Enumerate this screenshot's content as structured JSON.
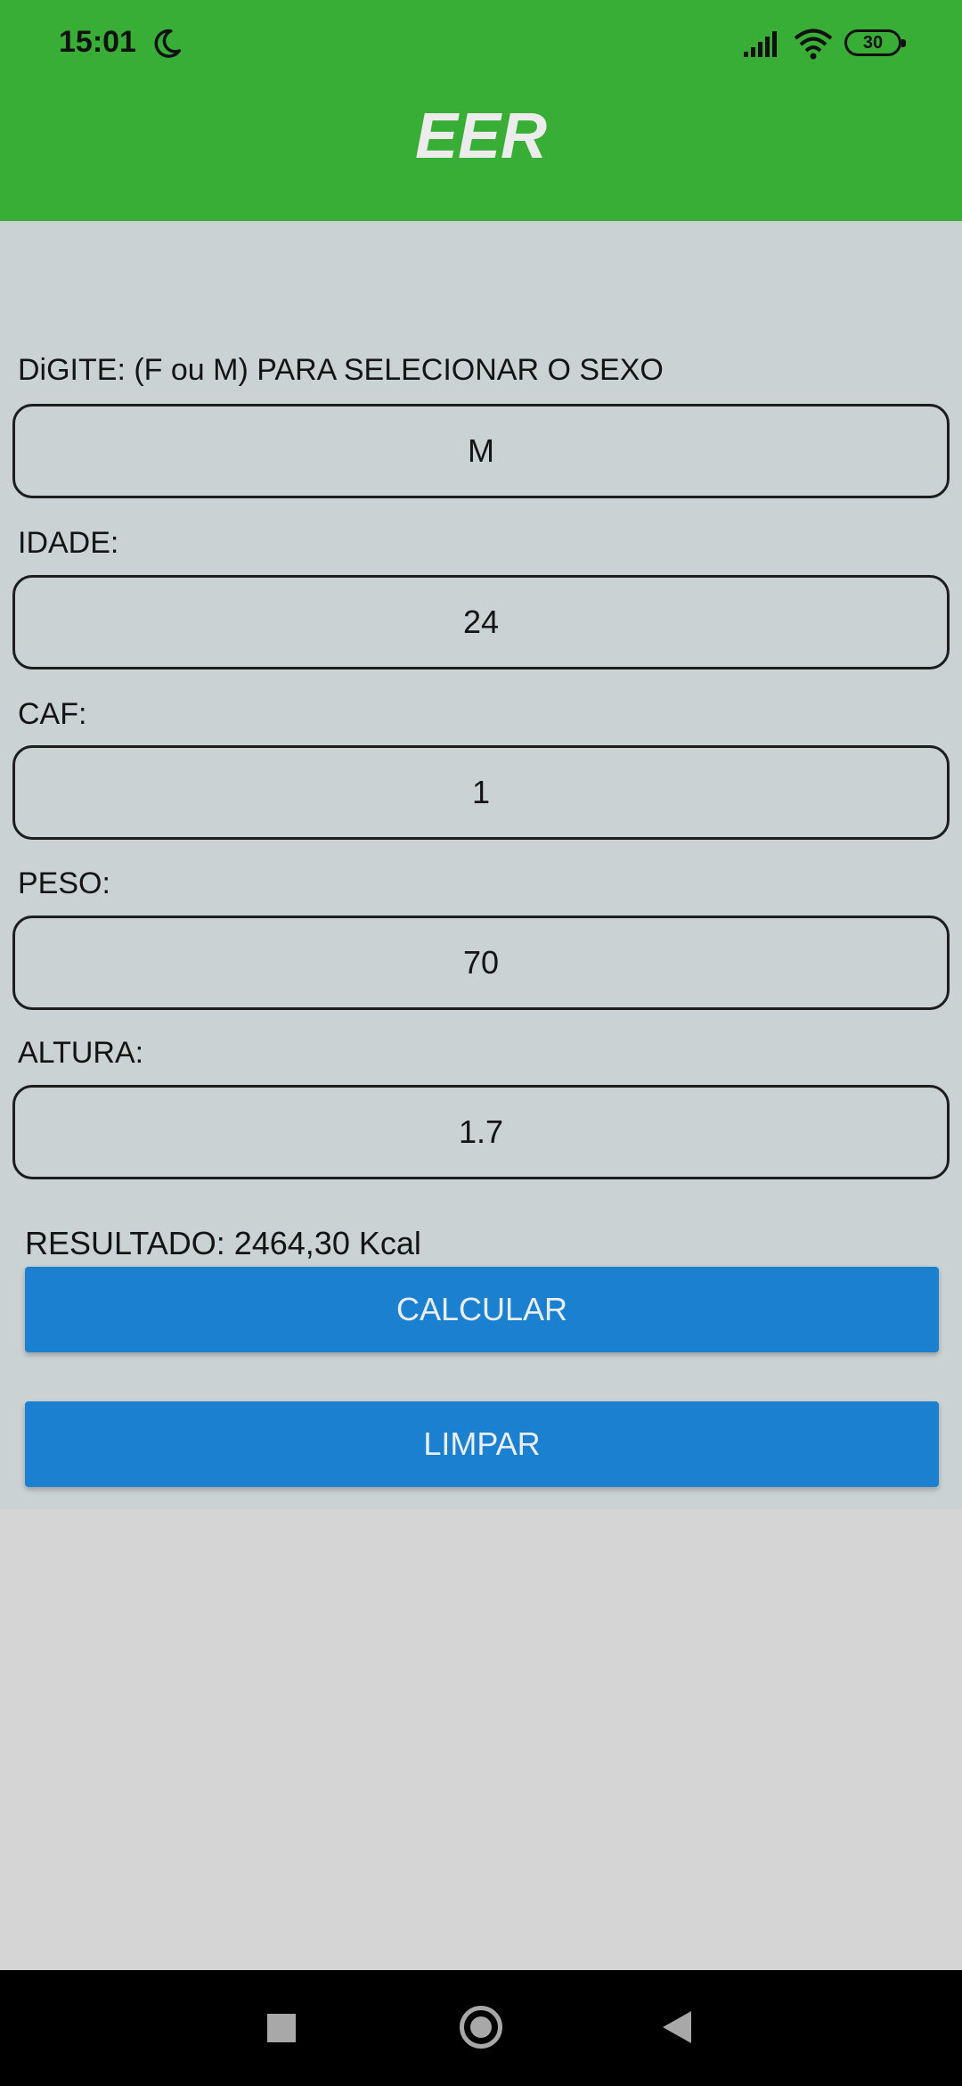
{
  "status_bar": {
    "time": "15:01",
    "battery": "30",
    "icons": [
      "moon-icon",
      "signal-icon",
      "wifi-icon",
      "battery-icon"
    ]
  },
  "app_bar": {
    "title": "EER"
  },
  "form": {
    "sexo": {
      "label": "DiGITE: (F ou M) PARA SELECIONAR O SEXO",
      "value": "M"
    },
    "idade": {
      "label": "IDADE:",
      "value": "24"
    },
    "caf": {
      "label": "CAF:",
      "value": "1"
    },
    "peso": {
      "label": "PESO:",
      "value": "70"
    },
    "altura": {
      "label": "ALTURA:",
      "value": "1.7"
    }
  },
  "result": {
    "text": "RESULTADO: 2464,30 Kcal"
  },
  "buttons": {
    "calcular": "CALCULAR",
    "limpar": "LIMPAR"
  },
  "nav_bar": {
    "icons": [
      "recent-apps-icon",
      "home-icon",
      "back-icon"
    ]
  },
  "colors": {
    "app_bar": "#39ae37",
    "button": "#1b80cf",
    "content_bg": "#cbd2d4",
    "page_bg": "#d5d5d5",
    "nav_bar": "#000000"
  }
}
